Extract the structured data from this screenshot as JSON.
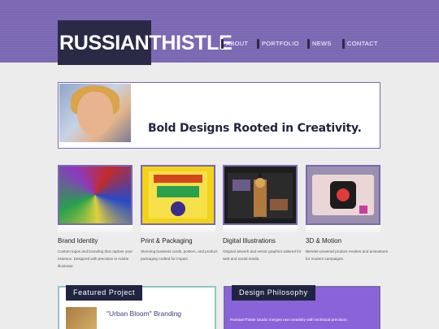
{
  "header": {
    "logo": "RUSSIANTHISTLE",
    "nav": [
      "ABOUT",
      "PORTFOLIO",
      "NEWS",
      "CONTACT"
    ]
  },
  "hero": {
    "tagline": "Bold Designs Rooted in Creativity."
  },
  "cards": [
    {
      "title": "Brand Identity",
      "desc": "Custom logos and branding that capture your essence. Designed with precision in Adobe Illustrator."
    },
    {
      "title": "Print & Packaging",
      "desc": "Stunning business cards, posters, and product packaging crafted for impact."
    },
    {
      "title": "Digital Illustrations",
      "desc": "Original artwork and vector graphics tailored for web and social media."
    },
    {
      "title": "3D & Motion",
      "desc": "Blender-powered product renders and animations for modern campaigns."
    }
  ],
  "featured": {
    "label": "Featured Project",
    "project_title": "\"Urban Bloom\" Branding"
  },
  "philosophy": {
    "label": "Design Philosophy",
    "text": "RussianThistle Studio merges raw creativity with technical precision."
  },
  "colors": {
    "accent": "#7b68b3",
    "dark": "#1f2540"
  }
}
